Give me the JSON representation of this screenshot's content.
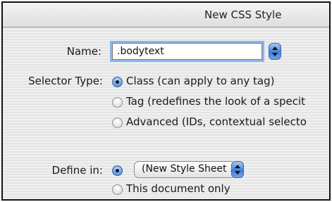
{
  "window": {
    "title": "New CSS Style"
  },
  "name_field": {
    "label": "Name:",
    "value": ".bodytext"
  },
  "selector_type": {
    "label": "Selector Type:",
    "options": [
      {
        "label": "Class (can apply to any tag)",
        "selected": true
      },
      {
        "label": "Tag (redefines the look of a specit",
        "selected": false
      },
      {
        "label": "Advanced (IDs, contextual selecto",
        "selected": false
      }
    ]
  },
  "define_in": {
    "label": "Define in:",
    "options": [
      {
        "label": "(New Style Sheet ...",
        "selected": true
      },
      {
        "label": "This document only",
        "selected": false
      }
    ]
  },
  "icons": {
    "stepper": "up-down-arrows-icon"
  }
}
